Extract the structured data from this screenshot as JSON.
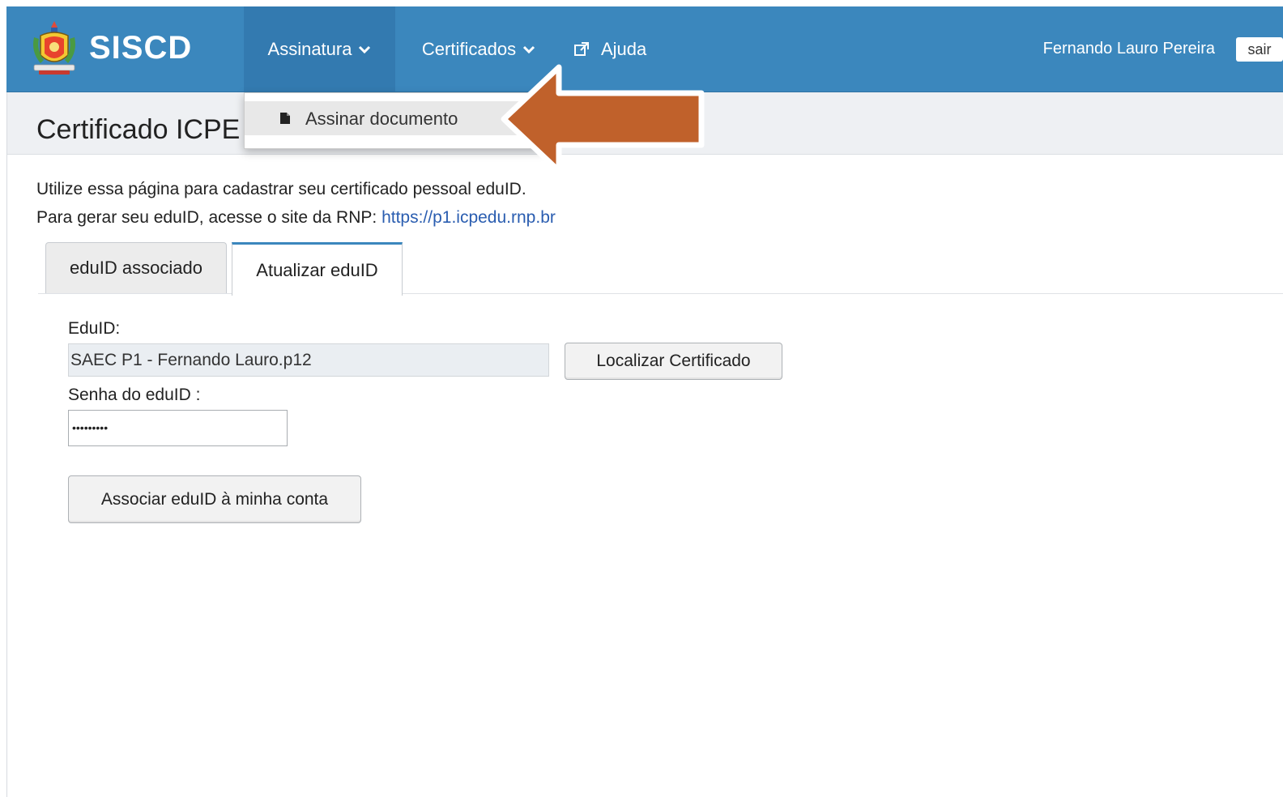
{
  "navbar": {
    "brand": "SISCD",
    "menu": [
      {
        "label": "Assinatura",
        "icon": "chevron-down-icon"
      },
      {
        "label": "Certificados",
        "icon": "chevron-down-icon"
      },
      {
        "label": "Ajuda",
        "icon": "external-link-icon"
      }
    ],
    "user_name": "Fernando Lauro Pereira",
    "logout_label": "sair"
  },
  "dropdown": {
    "items": [
      {
        "label": "Assinar documento",
        "icon": "document-icon"
      }
    ]
  },
  "page": {
    "title": "Certificado ICPE",
    "intro_line1": "Utilize essa página para cadastrar seu certificado pessoal eduID.",
    "intro_line2_prefix": "Para gerar seu eduID, acesse o site da RNP: ",
    "intro_link": "https://p1.icpedu.rnp.br"
  },
  "tabs": [
    {
      "label": "eduID associado",
      "active": false
    },
    {
      "label": "Atualizar eduID",
      "active": true
    }
  ],
  "form": {
    "eduid_label": "EduID:",
    "eduid_value": "SAEC P1 - Fernando Lauro.p12",
    "locate_button": "Localizar Certificado",
    "password_label": "Senha do eduID :",
    "password_value": "•••••••••",
    "submit_button": "Associar eduID à minha conta"
  },
  "colors": {
    "navbar": "#3b87bd",
    "annotation_arrow": "#c0612b",
    "link": "#2a5db0"
  }
}
